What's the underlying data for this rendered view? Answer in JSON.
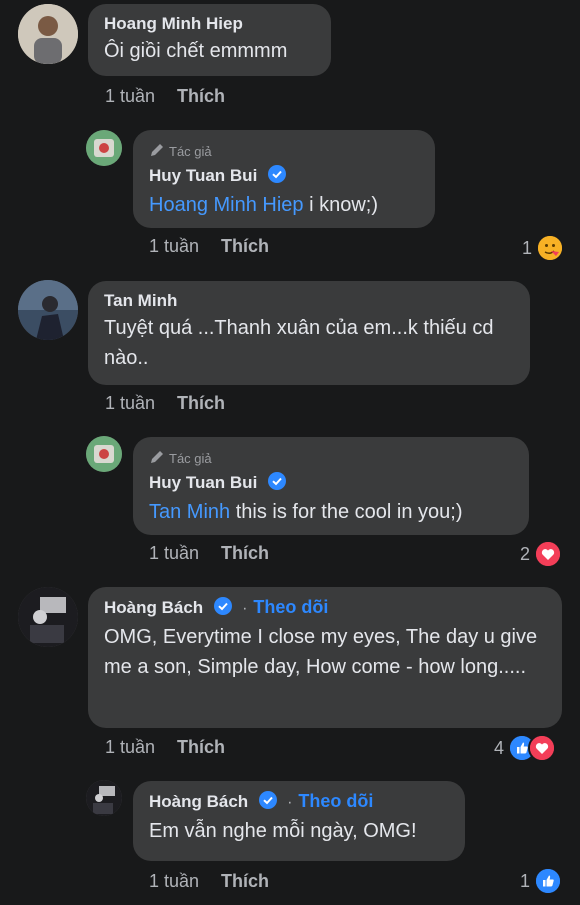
{
  "comments": [
    {
      "author": "Hoang Minh Hiep",
      "text": "Ôi giồi chết emmmm",
      "time": "1 tuần",
      "like_label": "Thích"
    },
    {
      "reply_tag": "Tác giả",
      "author": "Huy Tuan Bui",
      "mention": "Hoang Minh Hiep",
      "text": " i  know;)",
      "time": "1 tuần",
      "like_label": "Thích",
      "reaction_count": "1",
      "reaction_type": "care"
    },
    {
      "author": "Tan Minh",
      "text": "Tuyệt quá ...Thanh xuân của em...k thiếu cd nào..",
      "time": "1 tuần",
      "like_label": "Thích"
    },
    {
      "reply_tag": "Tác giả",
      "author": "Huy Tuan Bui",
      "mention": "Tan Minh",
      "text": " this is for the cool in you;)",
      "time": "1 tuần",
      "like_label": "Thích",
      "reaction_count": "2",
      "reaction_type": "love"
    },
    {
      "author": "Hoàng Bách",
      "follow_label": "Theo dõi",
      "text": "OMG, Everytime I close my eyes, The day u give me a son, Simple day, How come - how long.....",
      "time": "1 tuần",
      "like_label": "Thích",
      "reaction_count": "4",
      "reaction_type": "like-love"
    },
    {
      "author": "Hoàng Bách",
      "follow_label": "Theo dõi",
      "text": "Em vẫn nghe mỗi ngày, OMG!",
      "time": "1 tuần",
      "like_label": "Thích",
      "reaction_count": "1",
      "reaction_type": "like"
    }
  ],
  "colors": {
    "background": "#18191a",
    "bubble": "#3a3b3c",
    "link": "#4599ff",
    "verified": "#2d88ff",
    "muted": "#b0b3b8"
  }
}
